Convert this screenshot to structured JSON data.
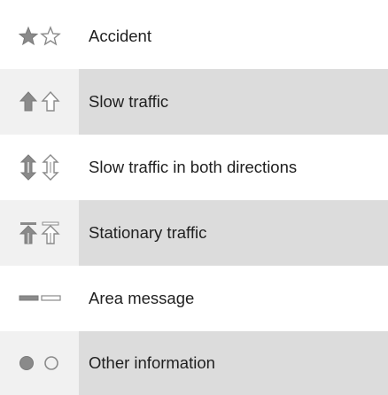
{
  "legend": {
    "items": [
      {
        "icon": "star-icons",
        "label": "Accident"
      },
      {
        "icon": "single-arrow-icons",
        "label": "Slow traffic"
      },
      {
        "icon": "double-arrow-icons",
        "label": "Slow traffic in both directions"
      },
      {
        "icon": "stop-arrow-icons",
        "label": "Stationary traffic"
      },
      {
        "icon": "area-bar-icons",
        "label": "Area message"
      },
      {
        "icon": "circle-icons",
        "label": "Other information"
      }
    ]
  },
  "colors": {
    "icon_filled": "#8a8a8a",
    "icon_outline": "#8a8a8a",
    "row_alt_label": "#dcdcdc",
    "row_alt_icon": "#f1f1f1",
    "text": "#1f1f1f"
  }
}
